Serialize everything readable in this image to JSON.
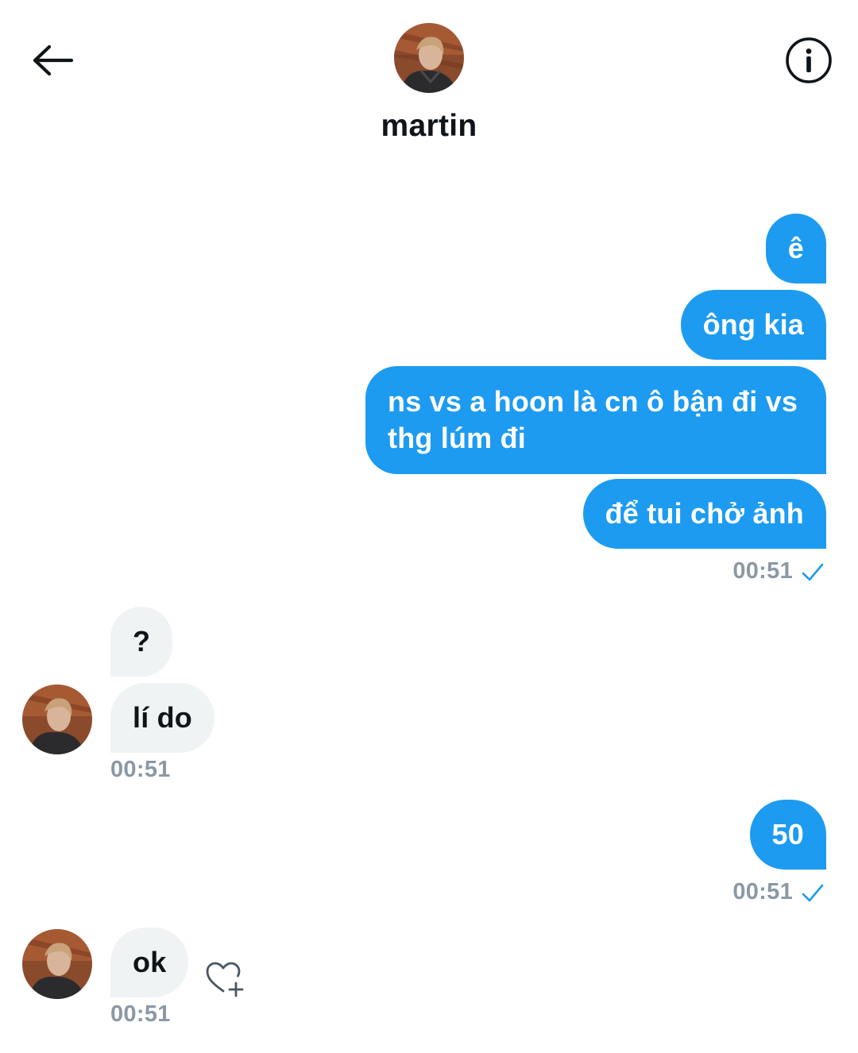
{
  "header": {
    "back_icon": "arrow-left-icon",
    "info_icon": "info-circle-icon",
    "contact_name": "martin"
  },
  "colors": {
    "outgoing_bubble": "#1d9bf0",
    "incoming_bubble": "#eff3f4",
    "timestamp": "#8b98a5",
    "read_check": "#1d9bf0"
  },
  "messages": [
    {
      "direction": "out",
      "text": "ê"
    },
    {
      "direction": "out",
      "text": "ông kia"
    },
    {
      "direction": "out",
      "text": "ns vs a hoon là cn ô bận đi vs thg lúm đi"
    },
    {
      "direction": "out",
      "text": "để tui chở ảnh"
    },
    {
      "direction": "in",
      "text": "?"
    },
    {
      "direction": "in",
      "text": "lí do"
    },
    {
      "direction": "out",
      "text": "50"
    },
    {
      "direction": "in",
      "text": "ok"
    }
  ],
  "timestamps": {
    "group1": "00:51",
    "group2": "00:51",
    "group3": "00:51",
    "group4": "00:51"
  }
}
